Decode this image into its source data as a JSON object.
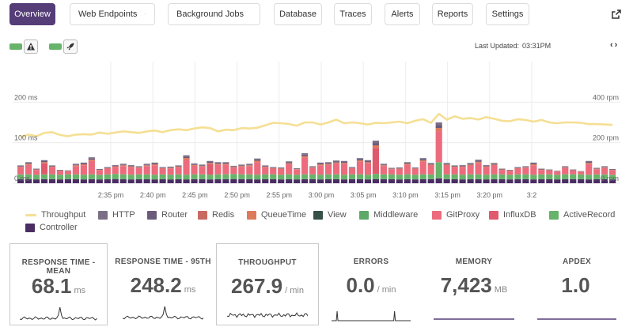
{
  "nav": {
    "tabs": [
      {
        "label": "Overview",
        "dropdown": false,
        "active": true
      },
      {
        "label": "Web Endpoints",
        "dropdown": true,
        "active": false
      },
      {
        "label": "Background Jobs",
        "dropdown": true,
        "active": false
      },
      {
        "label": "Database",
        "dropdown": false,
        "active": false
      },
      {
        "label": "Traces",
        "dropdown": false,
        "active": false
      },
      {
        "label": "Alerts",
        "dropdown": false,
        "active": false
      },
      {
        "label": "Reports",
        "dropdown": false,
        "active": false
      },
      {
        "label": "Settings",
        "dropdown": false,
        "active": false
      }
    ],
    "external_link_icon": "external-link-icon"
  },
  "toolbar": {
    "toggle_icons": [
      "warning-icon",
      "rocket-icon"
    ],
    "last_updated_label": "Last Updated:",
    "last_updated_time": "03:31PM",
    "prev_label": "‹",
    "next_label": "›"
  },
  "chart_data": {
    "type": "bar",
    "stacked": true,
    "x_ticks": [
      "2:35 pm",
      "2:40 pm",
      "2:45 pm",
      "2:50 pm",
      "2:55 pm",
      "3:00 pm",
      "3:05 pm",
      "3:10 pm",
      "3:15 pm",
      "3:20 pm",
      "3:2"
    ],
    "y_left_ticks": [
      "0 ms",
      "100 ms",
      "200 ms"
    ],
    "y_right_ticks": [
      "0 rpm",
      "200 rpm",
      "400 rpm"
    ],
    "ylim_ms": [
      0,
      300
    ],
    "ylim_rpm": [
      0,
      600
    ],
    "series_order": [
      "Controller",
      "ActiveRecord",
      "InfluxDB",
      "GitProxy",
      "Middleware",
      "View",
      "QueueTime",
      "Redis",
      "Router",
      "HTTP"
    ],
    "colors": {
      "Controller": "#4a2d63",
      "ActiveRecord": "#67b36a",
      "InfluxDB": "#e05a6e",
      "GitProxy": "#ec6b7d",
      "Middleware": "#5ea868",
      "View": "#36504a",
      "QueueTime": "#dd7a5c",
      "Redis": "#c86a62",
      "Router": "#6b5a7a",
      "HTTP": "#7a6f86",
      "Throughput": "#f5df93"
    },
    "base_ms": [
      22,
      22,
      21,
      22,
      22,
      21,
      22,
      22,
      21,
      22,
      21,
      22,
      23,
      22,
      21,
      22,
      22,
      21,
      22,
      21,
      22,
      21,
      22,
      22,
      21,
      22,
      22,
      23,
      22,
      22,
      21,
      22,
      22,
      21,
      22,
      21,
      22,
      22,
      21,
      22,
      22,
      21,
      22,
      22,
      21,
      23,
      22,
      22,
      21,
      22,
      21,
      22,
      22,
      21,
      22,
      22,
      21,
      22,
      22,
      21,
      22,
      22,
      21,
      22,
      22,
      21,
      22,
      22,
      21,
      22,
      22,
      22,
      21,
      22,
      22,
      21
    ],
    "top_ms": [
      22,
      30,
      15,
      35,
      22,
      12,
      10,
      26,
      30,
      42,
      14,
      18,
      22,
      26,
      24,
      20,
      26,
      30,
      18,
      20,
      22,
      48,
      27,
      24,
      34,
      30,
      30,
      20,
      24,
      26,
      40,
      22,
      18,
      18,
      32,
      16,
      52,
      20,
      30,
      30,
      34,
      34,
      18,
      40,
      36,
      28,
      26,
      16,
      18,
      30,
      18,
      40,
      28,
      30,
      28,
      22,
      24,
      28,
      36,
      24,
      28,
      14,
      12,
      18,
      20,
      30,
      14,
      12,
      10,
      20,
      12,
      8,
      34,
      16,
      20,
      14
    ],
    "spike": {
      "index": 53,
      "top_ms": 150
    },
    "spike2": {
      "index": 45,
      "top_ms": 105
    },
    "throughput_rpm": [
      228,
      240,
      232,
      248,
      252,
      238,
      232,
      240,
      242,
      240,
      250,
      244,
      250,
      256,
      252,
      248,
      256,
      260,
      252,
      262,
      266,
      262,
      270,
      276,
      272,
      256,
      264,
      262,
      272,
      270,
      274,
      286,
      298,
      296,
      292,
      284,
      300,
      300,
      290,
      300,
      314,
      296,
      300,
      296,
      290,
      298,
      296,
      300,
      304,
      296,
      308,
      316,
      298,
      342,
      314,
      330,
      318,
      322,
      314,
      326,
      318,
      308,
      306,
      316,
      312,
      304,
      312,
      300,
      296,
      300,
      300,
      298,
      292,
      292,
      290,
      288
    ],
    "legend_layout": "bottom"
  },
  "legend": [
    {
      "label": "Throughput",
      "key": "Throughput",
      "kind": "line"
    },
    {
      "label": "HTTP",
      "key": "HTTP",
      "kind": "box"
    },
    {
      "label": "Router",
      "key": "Router",
      "kind": "box"
    },
    {
      "label": "Redis",
      "key": "Redis",
      "kind": "box"
    },
    {
      "label": "QueueTime",
      "key": "QueueTime",
      "kind": "box"
    },
    {
      "label": "View",
      "key": "View",
      "kind": "box"
    },
    {
      "label": "Middleware",
      "key": "Middleware",
      "kind": "box"
    },
    {
      "label": "GitProxy",
      "key": "GitProxy",
      "kind": "box"
    },
    {
      "label": "InfluxDB",
      "key": "InfluxDB",
      "kind": "box"
    },
    {
      "label": "ActiveRecord",
      "key": "ActiveRecord",
      "kind": "box"
    },
    {
      "label": "Controller",
      "key": "Controller",
      "kind": "box"
    }
  ],
  "stats": [
    {
      "title": "RESPONSE TIME - MEAN",
      "value": "68.1",
      "unit": "ms",
      "spark": "spike"
    },
    {
      "title": "RESPONSE TIME - 95TH",
      "value": "248.2",
      "unit": "ms",
      "spark": "spike"
    },
    {
      "title": "THROUGHPUT",
      "value": "267.9",
      "unit": "/ min",
      "spark": "noisy"
    },
    {
      "title": "ERRORS",
      "value": "0.0",
      "unit": "/ min",
      "spark": "twin"
    },
    {
      "title": "MEMORY",
      "value": "7,423",
      "unit": "MB",
      "spark": "flat"
    },
    {
      "title": "APDEX",
      "value": "1.0",
      "unit": "",
      "spark": "flat"
    }
  ]
}
